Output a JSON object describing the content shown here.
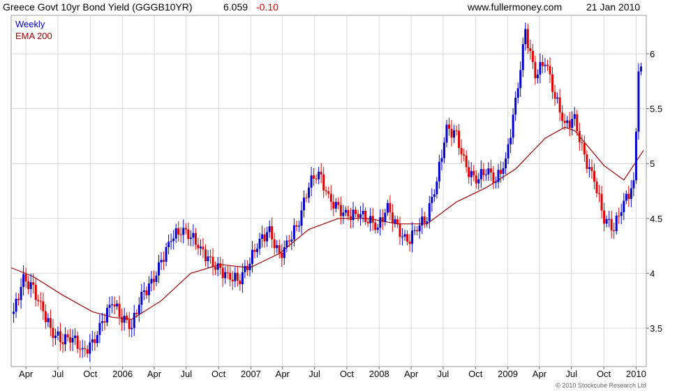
{
  "header": {
    "instrument": "Greece Govt 10yr Bond Yield (GGGB10YR)",
    "last": "6.059",
    "change": "-0.10",
    "site": "www.fullermoney.com",
    "date": "21 Jan 2010"
  },
  "legend": {
    "weekly": "Weekly",
    "ema": "EMA 200"
  },
  "copyright": "© 2010 Stockcube Research Ltd",
  "colors": {
    "up": "#0000cc",
    "down": "#dd0000",
    "ema": "#990000",
    "grid": "#d8d8d8",
    "change": "#dd0000"
  },
  "chart_data": {
    "type": "line",
    "subtype": "weekly candlestick with EMA 200 overlay",
    "grid": true,
    "y_axis_position": "right",
    "ylim": [
      3.15,
      6.35
    ],
    "yticks": [
      3.5,
      4,
      4.5,
      5,
      5.5,
      6
    ],
    "ytick_labels": [
      "3.5",
      "4",
      "4.5",
      "5",
      "5.5",
      "6"
    ],
    "xlim": [
      "2005-02-18",
      "2010-01-30"
    ],
    "x_ticks": [
      {
        "date": "2005-04-01",
        "label": "Apr"
      },
      {
        "date": "2005-07-01",
        "label": "Jul"
      },
      {
        "date": "2005-10-01",
        "label": "Oct"
      },
      {
        "date": "2006-01-01",
        "label": "2006"
      },
      {
        "date": "2006-04-01",
        "label": "Apr"
      },
      {
        "date": "2006-07-01",
        "label": "Jul"
      },
      {
        "date": "2006-10-01",
        "label": "Oct"
      },
      {
        "date": "2007-01-01",
        "label": "2007"
      },
      {
        "date": "2007-04-01",
        "label": "Apr"
      },
      {
        "date": "2007-07-01",
        "label": "Jul"
      },
      {
        "date": "2007-10-01",
        "label": "Oct"
      },
      {
        "date": "2008-01-01",
        "label": "2008"
      },
      {
        "date": "2008-04-01",
        "label": "Apr"
      },
      {
        "date": "2008-07-01",
        "label": "Jul"
      },
      {
        "date": "2008-10-01",
        "label": "Oct"
      },
      {
        "date": "2009-01-01",
        "label": "2009"
      },
      {
        "date": "2009-04-01",
        "label": "Apr"
      },
      {
        "date": "2009-07-01",
        "label": "Jul"
      },
      {
        "date": "2009-10-01",
        "label": "Oct"
      },
      {
        "date": "2010-01-01",
        "label": "2010"
      }
    ],
    "series": [
      {
        "name": "Weekly",
        "kind": "candlestick",
        "note": "weekly closing yield (approx.)",
        "x": [
          "2005-02-25",
          "2005-03-25",
          "2005-04-22",
          "2005-05-20",
          "2005-06-17",
          "2005-07-15",
          "2005-08-12",
          "2005-09-09",
          "2005-10-07",
          "2005-11-04",
          "2005-12-02",
          "2005-12-30",
          "2006-01-27",
          "2006-02-24",
          "2006-03-24",
          "2006-04-21",
          "2006-05-19",
          "2006-06-16",
          "2006-07-14",
          "2006-08-11",
          "2006-09-08",
          "2006-10-06",
          "2006-11-03",
          "2006-12-01",
          "2006-12-29",
          "2007-01-26",
          "2007-02-23",
          "2007-03-23",
          "2007-04-20",
          "2007-05-18",
          "2007-06-15",
          "2007-07-13",
          "2007-08-10",
          "2007-09-07",
          "2007-10-05",
          "2007-11-02",
          "2007-11-30",
          "2007-12-28",
          "2008-01-25",
          "2008-02-22",
          "2008-03-21",
          "2008-04-18",
          "2008-05-16",
          "2008-06-13",
          "2008-07-11",
          "2008-08-08",
          "2008-09-05",
          "2008-10-03",
          "2008-10-31",
          "2008-11-28",
          "2008-12-26",
          "2009-01-23",
          "2009-02-20",
          "2009-03-20",
          "2009-04-17",
          "2009-05-15",
          "2009-06-12",
          "2009-07-10",
          "2009-08-07",
          "2009-09-04",
          "2009-10-02",
          "2009-10-30",
          "2009-11-27",
          "2009-12-25",
          "2010-01-08",
          "2010-01-22"
        ],
        "values": [
          3.65,
          3.95,
          3.85,
          3.65,
          3.45,
          3.4,
          3.42,
          3.28,
          3.35,
          3.55,
          3.75,
          3.6,
          3.52,
          3.8,
          3.9,
          4.1,
          4.32,
          4.4,
          4.35,
          4.22,
          4.1,
          4.02,
          3.96,
          3.95,
          4.12,
          4.3,
          4.38,
          4.15,
          4.3,
          4.48,
          4.82,
          4.92,
          4.68,
          4.58,
          4.52,
          4.55,
          4.5,
          4.42,
          4.6,
          4.4,
          4.28,
          4.42,
          4.52,
          4.85,
          5.32,
          5.25,
          4.95,
          4.85,
          4.95,
          4.85,
          5.02,
          5.55,
          6.2,
          5.8,
          5.95,
          5.62,
          5.35,
          5.4,
          5.05,
          4.85,
          4.5,
          4.42,
          4.65,
          4.8,
          5.8,
          6.06
        ]
      },
      {
        "name": "EMA 200",
        "kind": "line",
        "x": [
          "2005-02-18",
          "2005-04-22",
          "2005-07-15",
          "2005-10-07",
          "2005-12-02",
          "2006-01-27",
          "2006-04-21",
          "2006-07-14",
          "2006-10-06",
          "2006-12-29",
          "2007-03-23",
          "2007-06-15",
          "2007-09-07",
          "2007-11-30",
          "2008-02-22",
          "2008-05-16",
          "2008-08-08",
          "2008-10-31",
          "2009-01-23",
          "2009-04-17",
          "2009-06-12",
          "2009-07-10",
          "2009-10-02",
          "2009-11-27",
          "2010-01-22"
        ],
        "values": [
          4.05,
          3.97,
          3.8,
          3.65,
          3.6,
          3.58,
          3.75,
          4.0,
          4.08,
          4.05,
          4.18,
          4.4,
          4.5,
          4.5,
          4.45,
          4.45,
          4.65,
          4.78,
          4.95,
          5.23,
          5.33,
          5.3,
          4.98,
          4.85,
          5.12
        ]
      }
    ]
  }
}
